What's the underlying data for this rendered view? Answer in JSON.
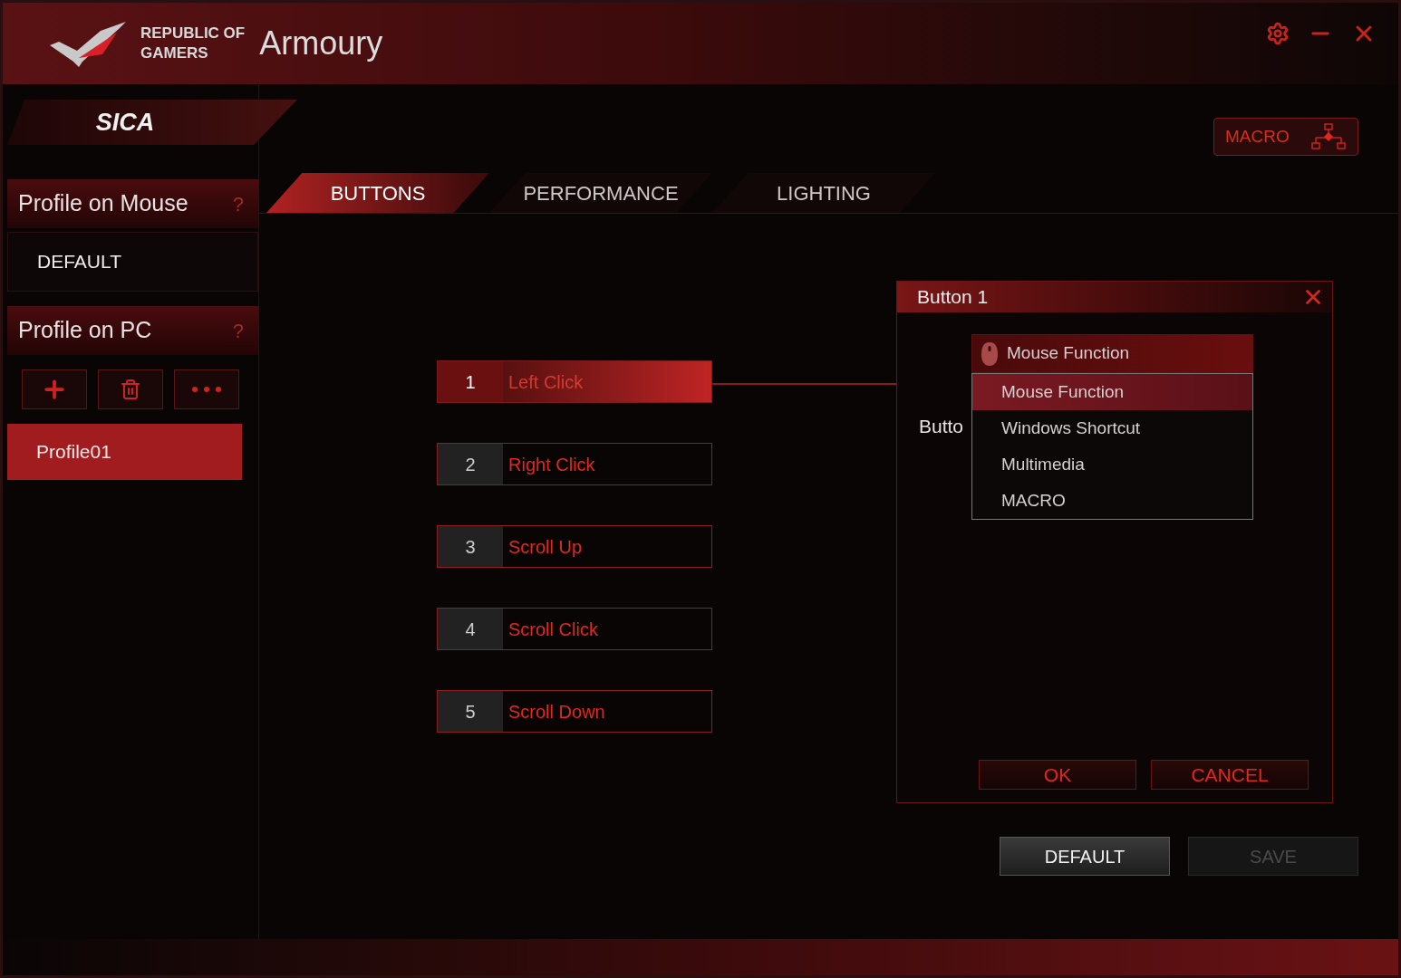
{
  "window": {
    "brand_line1": "REPUBLIC OF",
    "brand_line2": "GAMERS",
    "title": "Armoury"
  },
  "device": "SICA",
  "macro_button": "MACRO",
  "sidebar": {
    "mouse_section": {
      "title": "Profile on Mouse",
      "help": "?",
      "profiles": [
        {
          "name": "DEFAULT",
          "selected": false
        }
      ]
    },
    "pc_section": {
      "title": "Profile on PC",
      "help": "?",
      "profiles": [
        {
          "name": "Profile01",
          "selected": true
        }
      ]
    }
  },
  "tabs": [
    {
      "label": "BUTTONS",
      "selected": true
    },
    {
      "label": "PERFORMANCE",
      "selected": false
    },
    {
      "label": "LIGHTING",
      "selected": false
    }
  ],
  "buttons": [
    {
      "number": "1",
      "function": "Left Click",
      "selected": true
    },
    {
      "number": "2",
      "function": "Right Click",
      "selected": false
    },
    {
      "number": "3",
      "function": "Scroll Up",
      "selected": false
    },
    {
      "number": "4",
      "function": "Scroll Click",
      "selected": false
    },
    {
      "number": "5",
      "function": "Scroll Down",
      "selected": false
    }
  ],
  "dialog": {
    "title": "Button 1",
    "label": "Butto",
    "dropdown": {
      "value": "Mouse Function",
      "options": [
        {
          "label": "Mouse Function",
          "selected": true
        },
        {
          "label": "Windows Shortcut",
          "selected": false
        },
        {
          "label": "Multimedia",
          "selected": false
        },
        {
          "label": "MACRO",
          "selected": false
        }
      ]
    },
    "ok": "OK",
    "cancel": "CANCEL"
  },
  "footer": {
    "default": "DEFAULT",
    "save": {
      "label": "SAVE",
      "disabled": true
    }
  }
}
